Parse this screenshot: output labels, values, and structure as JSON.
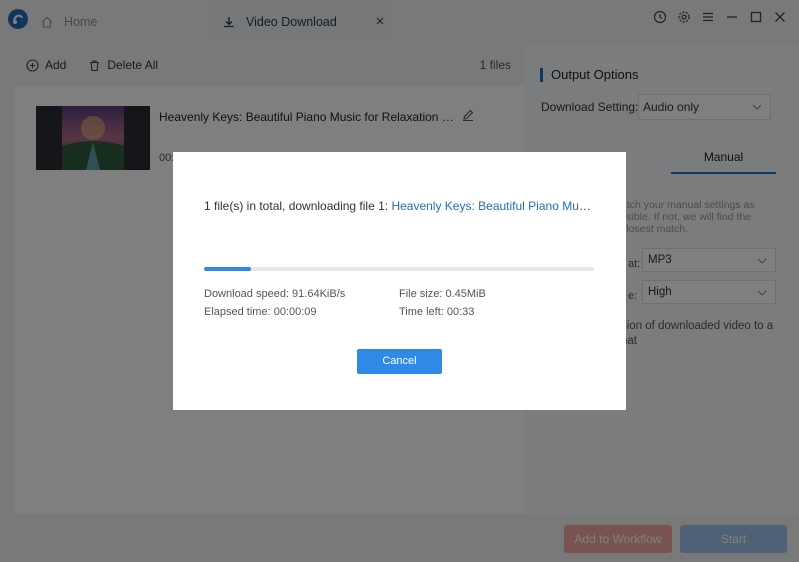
{
  "titlebar": {
    "home_tab_label": "Home",
    "active_tab_label": "Video Download"
  },
  "toolbar": {
    "add_label": "Add",
    "delete_all_label": "Delete All",
    "files_count": "1 files"
  },
  "file": {
    "title": "Heavenly Keys: Beautiful Piano Music for Relaxation and Me...",
    "duration_partial": "00:"
  },
  "output_options": {
    "title": "Output Options",
    "download_setting_label": "Download Setting:",
    "download_setting_value": "Audio only",
    "manual_tab": "Manual",
    "hint": "atch your manual settings as ssible. If not, we will find the closest match.",
    "format_label_frag": "at:",
    "format_value": "MP3",
    "quality_label_frag": "e:",
    "quality_value": "High",
    "note_frag": "sion of downloaded video to a nat"
  },
  "bottom": {
    "workflow_label": "Add to Workflow",
    "start_label": "Start"
  },
  "modal": {
    "status_prefix": "1 file(s) in total, downloading file 1: ",
    "status_filename": "Heavenly Keys: Beautiful Piano Music fo...",
    "progress": 0.12,
    "download_speed": "Download speed: 91.64KiB/s",
    "file_size": "File size: 0.45MiB",
    "elapsed": "Elapsed time: 00:00:09",
    "time_left": "Time left: 00:33",
    "cancel_label": "Cancel"
  },
  "colors": {
    "accent": "#2e8ae6",
    "link": "#1f6fb8",
    "workflow_button": "#f0a79f",
    "start_button": "#9fc3e8"
  }
}
